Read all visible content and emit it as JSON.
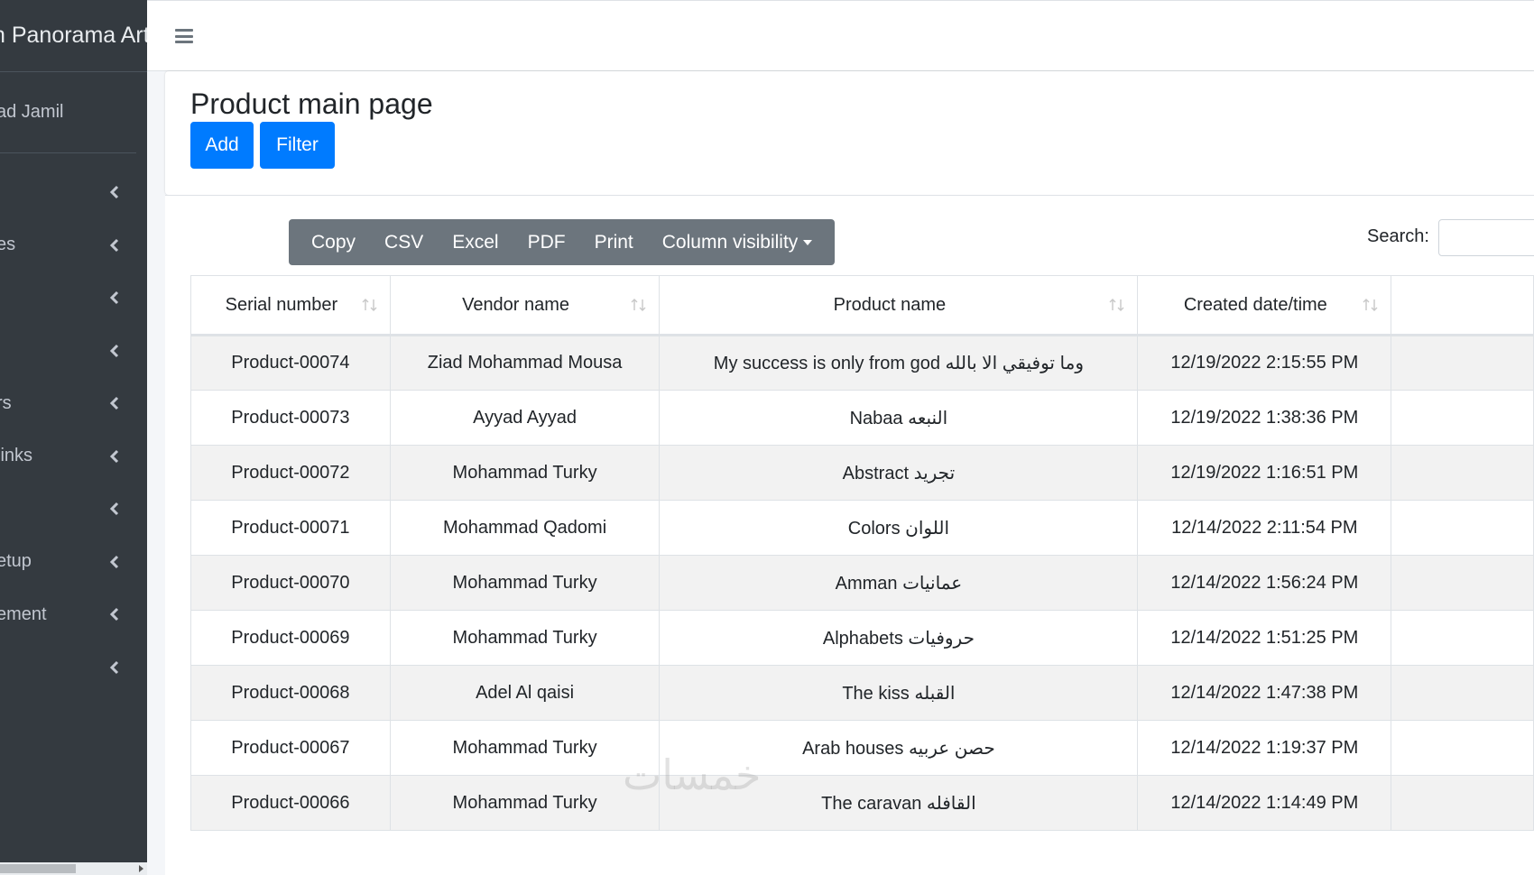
{
  "app": {
    "brand": "n Panorama Art",
    "user": "ad Jamil"
  },
  "sidebar": {
    "items": [
      {
        "label": ""
      },
      {
        "label": "es"
      },
      {
        "label": ""
      },
      {
        "label": ""
      },
      {
        "label": "rs"
      },
      {
        "label": " links"
      },
      {
        "label": ""
      },
      {
        "label": "etup"
      },
      {
        "label": "ement"
      },
      {
        "label": ""
      }
    ]
  },
  "header": {
    "title": "Product main page",
    "add_label": "Add",
    "filter_label": "Filter"
  },
  "toolbar": {
    "buttons": [
      "Copy",
      "CSV",
      "Excel",
      "PDF",
      "Print",
      "Column visibility"
    ],
    "search_label": "Search:"
  },
  "table": {
    "columns": [
      "Serial number",
      "Vendor name",
      "Product name",
      "Created date/time"
    ],
    "rows": [
      [
        "Product-00074",
        "Ziad Mohammad Mousa",
        "My success is only from god وما توفيقي الا بالله",
        "12/19/2022 2:15:55 PM"
      ],
      [
        "Product-00073",
        "Ayyad Ayyad",
        "Nabaa النبعه",
        "12/19/2022 1:38:36 PM"
      ],
      [
        "Product-00072",
        "Mohammad Turky",
        "Abstract تجريد",
        "12/19/2022 1:16:51 PM"
      ],
      [
        "Product-00071",
        "Mohammad Qadomi",
        "Colors اللوان",
        "12/14/2022 2:11:54 PM"
      ],
      [
        "Product-00070",
        "Mohammad Turky",
        "Amman عمانيات",
        "12/14/2022 1:56:24 PM"
      ],
      [
        "Product-00069",
        "Mohammad Turky",
        "Alphabets حروفيات",
        "12/14/2022 1:51:25 PM"
      ],
      [
        "Product-00068",
        "Adel Al qaisi",
        "The kiss القبله",
        "12/14/2022 1:47:38 PM"
      ],
      [
        "Product-00067",
        "Mohammad Turky",
        "Arab houses حصن عربيه",
        "12/14/2022 1:19:37 PM"
      ],
      [
        "Product-00066",
        "Mohammad Turky",
        "The caravan القافله",
        "12/14/2022 1:14:49 PM"
      ]
    ]
  },
  "watermark": "خمسات",
  "colors": {
    "sidebar_bg": "#343a40",
    "primary": "#007bff",
    "toolbar_bg": "#6c757d"
  }
}
